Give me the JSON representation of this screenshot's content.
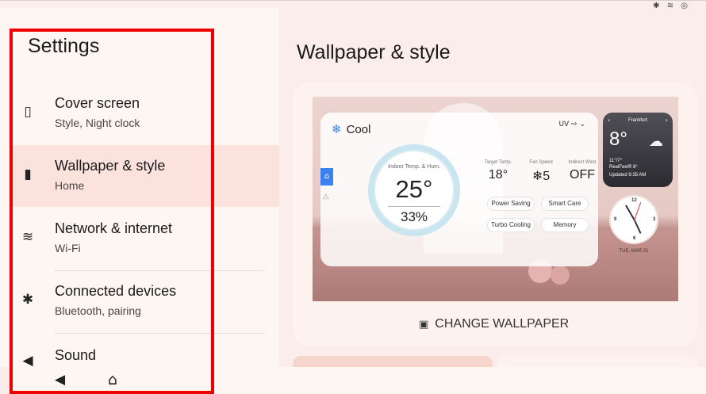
{
  "status_bar": {
    "icons": "✱ ≋ ◎"
  },
  "settings": {
    "title": "Settings",
    "items": [
      {
        "icon": "cover-screen-icon",
        "glyph": "⚙",
        "title": "Cover screen",
        "subtitle": "Style, Night clock",
        "active": false
      },
      {
        "icon": "wallpaper-icon",
        "glyph": "▮",
        "title": "Wallpaper & style",
        "subtitle": "Home",
        "active": true
      },
      {
        "icon": "wifi-icon",
        "glyph": "≋",
        "title": "Network & internet",
        "subtitle": "Wi-Fi",
        "active": false
      },
      {
        "icon": "bluetooth-icon",
        "glyph": "✱",
        "title": "Connected devices",
        "subtitle": "Bluetooth, pairing",
        "active": false
      },
      {
        "icon": "sound-icon",
        "glyph": "◀",
        "title": "Sound",
        "subtitle": "",
        "active": false
      }
    ]
  },
  "detail": {
    "title": "Wallpaper & style",
    "change_wallpaper_label": "CHANGE WALLPAPER"
  },
  "preview": {
    "mode": "Cool",
    "top_icons": "UV ⇨ ⌄",
    "indoor_caption": "Indoor Temp. & Hum.",
    "indoor_temp": "25°",
    "indoor_hum": "33%",
    "target_caption": "Target Temp.",
    "target_value": "18°",
    "fan_caption": "Fan Speed",
    "fan_value": "❄5",
    "wind_caption": "Indirect Wind",
    "wind_value": "OFF",
    "pills": [
      "Power Saving",
      "Smart Care",
      "Turbo Cooling",
      "Memory"
    ],
    "weather": {
      "city": "Frankfurt",
      "temp": "8°",
      "range": "11°/7°",
      "realfeel": "RealFeel® 8°",
      "updated": "Updated 9:35 AM"
    },
    "clock_date": "TUE, MAR 21"
  },
  "bottom_tabs": [
    "",
    ""
  ],
  "nav": {
    "back": "◀",
    "home": "⌂"
  },
  "colors": {
    "highlight": "#fbe2dc",
    "annotation": "#ee0000",
    "accent": "#3b82f0"
  }
}
